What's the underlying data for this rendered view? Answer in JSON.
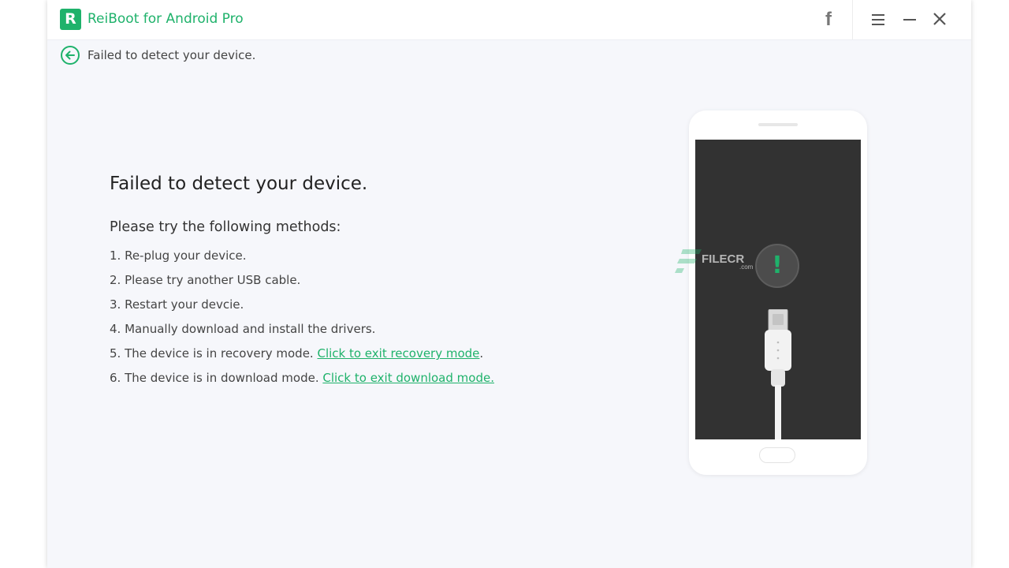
{
  "app": {
    "title": "ReiBoot for Android Pro",
    "logo_letter": "R",
    "accent_color": "#1fb26b"
  },
  "toolbar": {
    "facebook_icon": "facebook-icon",
    "facebook_glyph": "f",
    "menu_icon": "hamburger-menu-icon",
    "minimize_icon": "minimize-icon",
    "close_icon": "close-icon"
  },
  "breadcrumb": {
    "back_icon": "back-arrow-circle-icon",
    "text": "Failed to detect your device."
  },
  "main": {
    "title": "Failed to detect your device.",
    "subtitle": "Please try the following methods:",
    "methods": [
      {
        "text": "1. Re-plug your device."
      },
      {
        "text": "2. Please try another USB cable."
      },
      {
        "text": "3. Restart your devcie."
      },
      {
        "text": "4. Manually download and install the drivers."
      },
      {
        "text": "5. The device is in recovery mode. ",
        "link": "Click to exit recovery mode",
        "suffix": "."
      },
      {
        "text": "6. The device is in download mode. ",
        "link": "Click to exit download mode."
      }
    ]
  },
  "illustration": {
    "phone_icon": "phone-illustration",
    "alert_icon": "exclamation-icon",
    "alert_glyph": "!",
    "cable_icon": "usb-cable-icon"
  },
  "watermark": {
    "text": "FILECR",
    "sub": ".com"
  }
}
